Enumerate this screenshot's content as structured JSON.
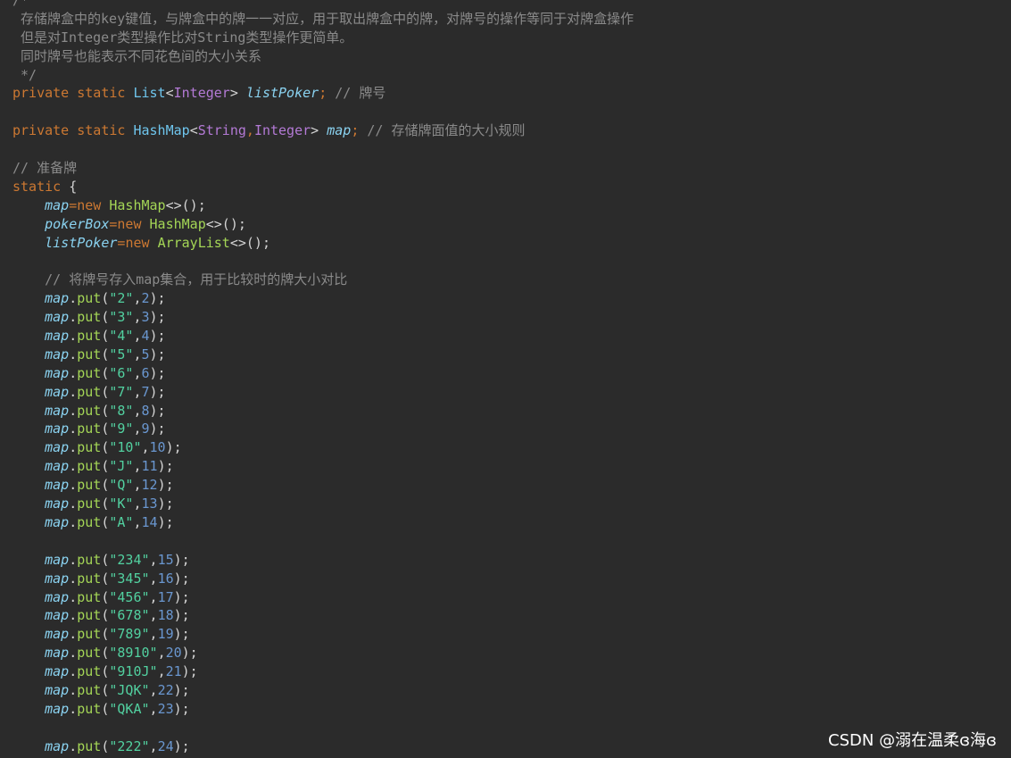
{
  "comment_block": {
    "open": "/*",
    "line1": " 存储牌盒中的key键值，与牌盒中的牌一一对应，用于取出牌盒中的牌，对牌号的操作等同于对牌盒操作",
    "line2": " 但是对Integer类型操作比对String类型操作更简单。",
    "line3": " 同时牌号也能表示不同花色间的大小关系",
    "close": " */"
  },
  "decl1": {
    "mod1": "private",
    "mod2": "static",
    "type": "List",
    "lt": "<",
    "generic": "Integer",
    "gt": ">",
    "name": "listPoker",
    "semi": ";",
    "comment": "// 牌号"
  },
  "decl2": {
    "mod1": "private",
    "mod2": "static",
    "type": "HashMap",
    "lt": "<",
    "generic1": "String",
    "comma": ",",
    "generic2": "Integer",
    "gt": ">",
    "name": "map",
    "semi": ";",
    "comment": "// 存储牌面值的大小规则"
  },
  "prep_comment": "// 准备牌",
  "static_block": {
    "kw": "static",
    "brace": "{"
  },
  "inits": [
    {
      "field": "map",
      "eq": "=",
      "kw": "new",
      "cls": "HashMap",
      "rest": "<>();"
    },
    {
      "field": "pokerBox",
      "eq": "=",
      "kw": "new",
      "cls": "HashMap",
      "rest": "<>();"
    },
    {
      "field": "listPoker",
      "eq": "=",
      "kw": "new",
      "cls": "ArrayList",
      "rest": "<>();"
    }
  ],
  "map_comment": "// 将牌号存入map集合，用于比较时的牌大小对比",
  "put_group1": [
    {
      "field": "map",
      "method": "put",
      "key": "\"2\"",
      "val": "2"
    },
    {
      "field": "map",
      "method": "put",
      "key": "\"3\"",
      "val": "3"
    },
    {
      "field": "map",
      "method": "put",
      "key": "\"4\"",
      "val": "4"
    },
    {
      "field": "map",
      "method": "put",
      "key": "\"5\"",
      "val": "5"
    },
    {
      "field": "map",
      "method": "put",
      "key": "\"6\"",
      "val": "6"
    },
    {
      "field": "map",
      "method": "put",
      "key": "\"7\"",
      "val": "7"
    },
    {
      "field": "map",
      "method": "put",
      "key": "\"8\"",
      "val": "8"
    },
    {
      "field": "map",
      "method": "put",
      "key": "\"9\"",
      "val": "9"
    },
    {
      "field": "map",
      "method": "put",
      "key": "\"10\"",
      "val": "10"
    },
    {
      "field": "map",
      "method": "put",
      "key": "\"J\"",
      "val": "11"
    },
    {
      "field": "map",
      "method": "put",
      "key": "\"Q\"",
      "val": "12"
    },
    {
      "field": "map",
      "method": "put",
      "key": "\"K\"",
      "val": "13"
    },
    {
      "field": "map",
      "method": "put",
      "key": "\"A\"",
      "val": "14"
    }
  ],
  "put_group2": [
    {
      "field": "map",
      "method": "put",
      "key": "\"234\"",
      "val": "15"
    },
    {
      "field": "map",
      "method": "put",
      "key": "\"345\"",
      "val": "16"
    },
    {
      "field": "map",
      "method": "put",
      "key": "\"456\"",
      "val": "17"
    },
    {
      "field": "map",
      "method": "put",
      "key": "\"678\"",
      "val": "18"
    },
    {
      "field": "map",
      "method": "put",
      "key": "\"789\"",
      "val": "19"
    },
    {
      "field": "map",
      "method": "put",
      "key": "\"8910\"",
      "val": "20"
    },
    {
      "field": "map",
      "method": "put",
      "key": "\"910J\"",
      "val": "21"
    },
    {
      "field": "map",
      "method": "put",
      "key": "\"JQK\"",
      "val": "22"
    },
    {
      "field": "map",
      "method": "put",
      "key": "\"QKA\"",
      "val": "23"
    }
  ],
  "put_group3": [
    {
      "field": "map",
      "method": "put",
      "key": "\"222\"",
      "val": "24"
    }
  ],
  "put_syntax": {
    "dot": ".",
    "open": "(",
    "comma": ",",
    "close": ");"
  },
  "watermark": "CSDN @溺在温柔ɞ海ɞ",
  "colors": {
    "background": "#2b2b2b",
    "keyword": "#cc7832",
    "comment": "#8a8a8a",
    "field": "#8ad2f0",
    "method": "#a4d656",
    "string": "#52d1a0",
    "number": "#6a97d0",
    "type_generic": "#b47ad6"
  }
}
